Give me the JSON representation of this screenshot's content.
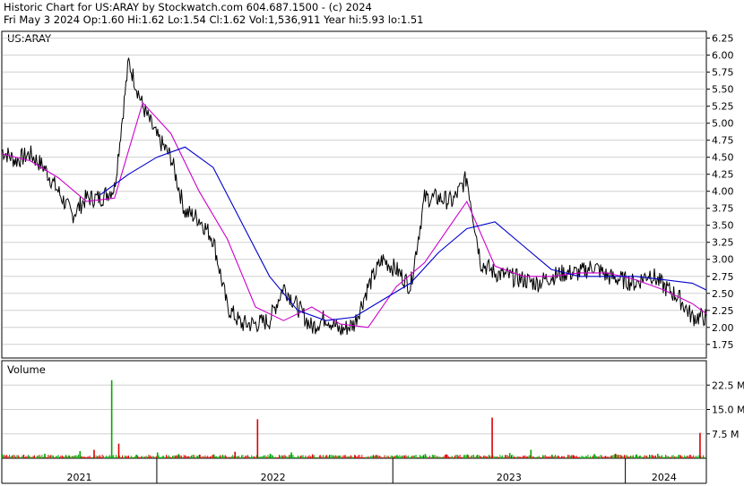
{
  "header": {
    "line1": "Historic Chart for US:ARAY by Stockwatch.com 604.687.1500 - (c) 2024",
    "line2": "Fri May  3 2024   Op:1.60  Hi:1.62  Lo:1.54  Cl:1.62  Vol:1,536,911  Year hi:5.93  lo:1.51"
  },
  "chart_data": [
    {
      "type": "line",
      "title": "US:ARAY",
      "x_labels": [
        "2021",
        "2022",
        "2023",
        "2024"
      ],
      "y_ticks": [
        "6.25",
        "6.00",
        "5.75",
        "5.50",
        "5.25",
        "5.00",
        "4.75",
        "4.50",
        "4.25",
        "4.00",
        "3.75",
        "3.50",
        "3.25",
        "3.00",
        "2.75",
        "2.50",
        "2.25",
        "2.00",
        "1.75"
      ],
      "ylim": [
        1.55,
        6.35
      ],
      "series": [
        {
          "role": "price",
          "color": "#000000",
          "x": [
            0,
            0.02,
            0.04,
            0.06,
            0.08,
            0.1,
            0.12,
            0.14,
            0.16,
            0.18,
            0.2,
            0.22,
            0.24,
            0.26,
            0.28,
            0.3,
            0.32,
            0.34,
            0.36,
            0.38,
            0.4,
            0.42,
            0.44,
            0.46,
            0.48,
            0.5,
            0.52,
            0.54,
            0.56,
            0.58,
            0.6,
            0.62,
            0.64,
            0.66,
            0.68,
            0.7,
            0.72,
            0.74,
            0.76,
            0.78,
            0.8,
            0.82,
            0.84,
            0.86,
            0.88,
            0.9,
            0.92,
            0.94,
            0.96,
            0.98,
            1.0
          ],
          "values": [
            4.6,
            4.45,
            4.55,
            4.35,
            4.0,
            3.65,
            3.9,
            3.9,
            4.05,
            5.9,
            5.25,
            4.8,
            4.5,
            3.7,
            3.6,
            3.3,
            2.3,
            2.05,
            2.05,
            2.1,
            2.6,
            2.3,
            2.0,
            2.15,
            1.95,
            2.05,
            2.6,
            3.0,
            2.85,
            2.6,
            3.9,
            3.9,
            3.85,
            4.2,
            2.95,
            2.8,
            2.75,
            2.7,
            2.65,
            2.75,
            2.8,
            2.8,
            2.9,
            2.75,
            2.7,
            2.65,
            2.8,
            2.6,
            2.45,
            2.15,
            2.15
          ]
        },
        {
          "role": "short moving average",
          "color": "#cc00cc",
          "x": [
            0,
            0.04,
            0.08,
            0.12,
            0.16,
            0.2,
            0.24,
            0.28,
            0.32,
            0.36,
            0.4,
            0.44,
            0.48,
            0.52,
            0.56,
            0.6,
            0.64,
            0.66,
            0.7,
            0.74,
            0.78,
            0.82,
            0.86,
            0.9,
            0.94,
            0.98,
            1.0
          ],
          "values": [
            4.55,
            4.45,
            4.2,
            3.85,
            3.9,
            5.3,
            4.85,
            4.0,
            3.3,
            2.3,
            2.1,
            2.3,
            2.05,
            2.0,
            2.6,
            2.95,
            3.55,
            3.85,
            2.9,
            2.75,
            2.75,
            2.8,
            2.8,
            2.7,
            2.55,
            2.35,
            2.2
          ]
        },
        {
          "role": "long moving average",
          "color": "#0000cc",
          "x": [
            0.14,
            0.18,
            0.22,
            0.26,
            0.3,
            0.34,
            0.38,
            0.42,
            0.46,
            0.5,
            0.54,
            0.58,
            0.62,
            0.66,
            0.7,
            0.74,
            0.78,
            0.82,
            0.86,
            0.9,
            0.94,
            0.98,
            1.0
          ],
          "values": [
            3.95,
            4.25,
            4.5,
            4.65,
            4.35,
            3.55,
            2.75,
            2.25,
            2.1,
            2.15,
            2.4,
            2.65,
            3.1,
            3.45,
            3.55,
            3.2,
            2.85,
            2.75,
            2.75,
            2.75,
            2.7,
            2.65,
            2.55
          ]
        }
      ]
    },
    {
      "type": "bar",
      "title": "Volume",
      "y_ticks": [
        "22.5 M",
        "15.0 M",
        "7.5 M"
      ],
      "ylim": [
        0,
        30
      ],
      "unit": "M",
      "bars": [
        {
          "x": 0.0,
          "v": 1.2
        },
        {
          "x": 0.03,
          "v": 1.1
        },
        {
          "x": 0.06,
          "v": 1.4
        },
        {
          "x": 0.09,
          "v": 1.0
        },
        {
          "x": 0.11,
          "v": 2.2
        },
        {
          "x": 0.13,
          "v": 2.6
        },
        {
          "x": 0.155,
          "v": 24.0
        },
        {
          "x": 0.165,
          "v": 4.5
        },
        {
          "x": 0.19,
          "v": 1.1
        },
        {
          "x": 0.22,
          "v": 1.8
        },
        {
          "x": 0.25,
          "v": 1.3
        },
        {
          "x": 0.28,
          "v": 1.1
        },
        {
          "x": 0.3,
          "v": 1.2
        },
        {
          "x": 0.33,
          "v": 2.0
        },
        {
          "x": 0.362,
          "v": 12.0
        },
        {
          "x": 0.38,
          "v": 1.4
        },
        {
          "x": 0.41,
          "v": 1.8
        },
        {
          "x": 0.44,
          "v": 1.2
        },
        {
          "x": 0.47,
          "v": 0.9
        },
        {
          "x": 0.5,
          "v": 1.0
        },
        {
          "x": 0.53,
          "v": 0.8
        },
        {
          "x": 0.56,
          "v": 1.0
        },
        {
          "x": 0.6,
          "v": 1.3
        },
        {
          "x": 0.63,
          "v": 1.2
        },
        {
          "x": 0.66,
          "v": 1.2
        },
        {
          "x": 0.695,
          "v": 12.5
        },
        {
          "x": 0.72,
          "v": 1.6
        },
        {
          "x": 0.75,
          "v": 2.6
        },
        {
          "x": 0.78,
          "v": 1.1
        },
        {
          "x": 0.81,
          "v": 1.0
        },
        {
          "x": 0.84,
          "v": 1.3
        },
        {
          "x": 0.87,
          "v": 1.4
        },
        {
          "x": 0.9,
          "v": 1.2
        },
        {
          "x": 0.93,
          "v": 1.4
        },
        {
          "x": 0.96,
          "v": 1.1
        },
        {
          "x": 0.99,
          "v": 7.8
        }
      ]
    }
  ],
  "colors": {
    "price": "#000000",
    "ma_short": "#cc00cc",
    "ma_long": "#0000cc",
    "vol_up": "#00aa00",
    "vol_down": "#dd0000",
    "grid": "#d0d0d0"
  }
}
